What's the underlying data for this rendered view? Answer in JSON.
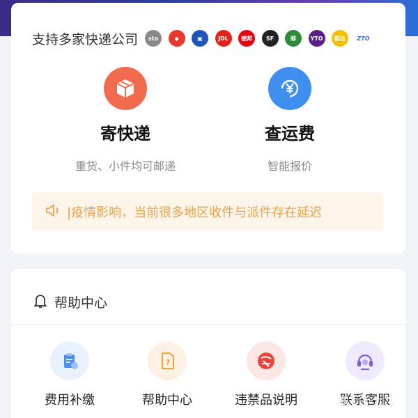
{
  "carriers": {
    "title": "支持多家快递公司",
    "logos": [
      {
        "icon": "sto-logo",
        "text": "sto",
        "color": "#8a8a8a"
      },
      {
        "icon": "red-logo",
        "text": "◆",
        "color": "#e8392e"
      },
      {
        "icon": "yunda-logo",
        "text": "▣",
        "color": "#1d57b8"
      },
      {
        "icon": "jdl-logo",
        "text": "JDL",
        "color": "#e2231a"
      },
      {
        "icon": "debang-logo",
        "text": "德邦",
        "color": "#e60012"
      },
      {
        "icon": "sf-logo",
        "text": "SF",
        "color": "#222222"
      },
      {
        "icon": "ems-logo",
        "text": "邮",
        "color": "#2e8b3a"
      },
      {
        "icon": "yto-logo",
        "text": "YTO",
        "color": "#5a1f86"
      },
      {
        "icon": "yunda-smile-logo",
        "text": "韵达",
        "color": "#f2c100"
      },
      {
        "icon": "zto-logo",
        "text": "ZTO",
        "color": "#3b6fd8"
      }
    ]
  },
  "services": {
    "send": {
      "title": "寄快递",
      "subtitle": "重货、小件均可邮递",
      "color": "#f26b4f"
    },
    "fee": {
      "title": "查运费",
      "subtitle": "智能报价",
      "color": "#3f8ff0"
    }
  },
  "notice": {
    "text": "|疫情影响，当前很多地区收件与派件存在延迟"
  },
  "help": {
    "title": "帮助中心",
    "items": [
      {
        "label": "费用补缴",
        "icon": "clipboard-icon",
        "bg": "#e9f1fd",
        "fg": "#4a8ff0"
      },
      {
        "label": "帮助中心",
        "icon": "question-doc-icon",
        "bg": "#fdf1e3",
        "fg": "#f0a03a"
      },
      {
        "label": "违禁品说明",
        "icon": "forbidden-icon",
        "bg": "#fde7e5",
        "fg": "#e8473c"
      },
      {
        "label": "联系客服",
        "icon": "headset-icon",
        "bg": "#efeafd",
        "fg": "#7a5ce0"
      }
    ]
  },
  "watermark": "知乎 @九九"
}
